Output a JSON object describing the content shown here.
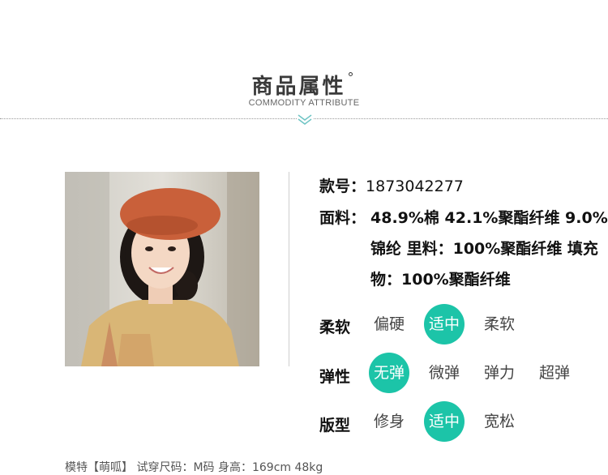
{
  "header": {
    "title": "商品属性",
    "degree": "°",
    "subtitle": "COMMODITY ATTRIBUTE"
  },
  "product": {
    "style_no_label": "款号：",
    "style_no_value": "1873042277",
    "fabric_label": "面料：",
    "fabric_line1": "48.9%棉 42.1%聚酯纤维 9.0%",
    "fabric_line2": "锦纶 里料：100%聚酯纤维 填充",
    "fabric_line3": "物：100%聚酯纤维"
  },
  "softness": {
    "label": "柔软",
    "options": [
      "偏硬",
      "适中",
      "柔软"
    ],
    "selected": "适中"
  },
  "elasticity": {
    "label": "弹性",
    "options": [
      "无弹",
      "微弹",
      "弹力",
      "超弹"
    ],
    "selected": "无弹"
  },
  "fit": {
    "label": "版型",
    "options": [
      "修身",
      "适中",
      "宽松"
    ],
    "selected": "适中"
  },
  "footer": {
    "model_info": "模特【萌呱】 试穿尺码：M码 身高：169cm 48kg"
  },
  "colors": {
    "accent": "#1cc4a8",
    "beret": "#c9603a",
    "sweater": "#d9b676"
  }
}
